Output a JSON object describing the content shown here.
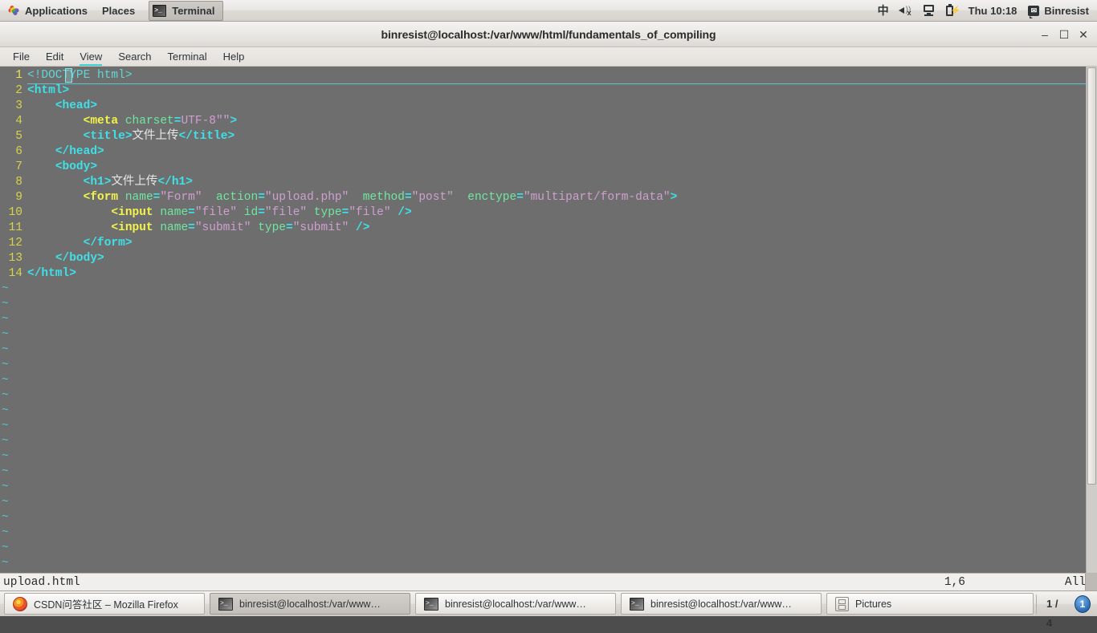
{
  "top_panel": {
    "applications_label": "Applications",
    "places_label": "Places",
    "window_task_label": "Terminal",
    "input_method": "中",
    "clock": "Thu 10:18",
    "user": "Binresist",
    "tray_icons": [
      "input-method-icon",
      "volume-muted-icon",
      "display-icon",
      "battery-icon",
      "messaging-icon"
    ]
  },
  "window": {
    "title": "binresist@localhost:/var/www/html/fundamentals_of_compiling",
    "minimize_glyph": "–",
    "maximize_glyph": "☐",
    "close_glyph": "✕",
    "menus": [
      {
        "label": "File",
        "active": false
      },
      {
        "label": "Edit",
        "active": false
      },
      {
        "label": "View",
        "active": true
      },
      {
        "label": "Search",
        "active": false
      },
      {
        "label": "Terminal",
        "active": false
      },
      {
        "label": "Help",
        "active": false
      }
    ]
  },
  "editor": {
    "lines": [
      {
        "num": "1",
        "cursor": true,
        "tokens": [
          {
            "t": "doctype",
            "v": "<!DOCTYPE html>"
          }
        ]
      },
      {
        "num": "2",
        "cursor": false,
        "tokens": [
          {
            "t": "tag",
            "v": "<html>"
          }
        ]
      },
      {
        "num": "3",
        "cursor": false,
        "tokens": [
          {
            "t": "txt",
            "v": "    "
          },
          {
            "t": "tag",
            "v": "<head>"
          }
        ]
      },
      {
        "num": "4",
        "cursor": false,
        "tokens": [
          {
            "t": "txt",
            "v": "        "
          },
          {
            "t": "tagb",
            "v": "<meta"
          },
          {
            "t": "txt",
            "v": " "
          },
          {
            "t": "attr",
            "v": "charset"
          },
          {
            "t": "eq",
            "v": "="
          },
          {
            "t": "str",
            "v": "UTF-8\"\""
          },
          {
            "t": "tag",
            "v": ">"
          }
        ]
      },
      {
        "num": "5",
        "cursor": false,
        "tokens": [
          {
            "t": "txt",
            "v": "        "
          },
          {
            "t": "tag",
            "v": "<title>"
          },
          {
            "t": "txt",
            "v": "文件上传"
          },
          {
            "t": "tag",
            "v": "</title>"
          }
        ]
      },
      {
        "num": "6",
        "cursor": false,
        "tokens": [
          {
            "t": "txt",
            "v": "    "
          },
          {
            "t": "tag",
            "v": "</head>"
          }
        ]
      },
      {
        "num": "7",
        "cursor": false,
        "tokens": [
          {
            "t": "txt",
            "v": "    "
          },
          {
            "t": "tag",
            "v": "<body>"
          }
        ]
      },
      {
        "num": "8",
        "cursor": false,
        "tokens": [
          {
            "t": "txt",
            "v": "        "
          },
          {
            "t": "tag",
            "v": "<h1>"
          },
          {
            "t": "txt",
            "v": "文件上传"
          },
          {
            "t": "tag",
            "v": "</h1>"
          }
        ]
      },
      {
        "num": "9",
        "cursor": false,
        "tokens": [
          {
            "t": "txt",
            "v": "        "
          },
          {
            "t": "tagb",
            "v": "<form"
          },
          {
            "t": "txt",
            "v": " "
          },
          {
            "t": "attr",
            "v": "name"
          },
          {
            "t": "eq",
            "v": "="
          },
          {
            "t": "str",
            "v": "\"Form\""
          },
          {
            "t": "txt",
            "v": "  "
          },
          {
            "t": "attr",
            "v": "action"
          },
          {
            "t": "eq",
            "v": "="
          },
          {
            "t": "str",
            "v": "\"upload.php\""
          },
          {
            "t": "txt",
            "v": "  "
          },
          {
            "t": "attr",
            "v": "method"
          },
          {
            "t": "eq",
            "v": "="
          },
          {
            "t": "str",
            "v": "\"post\""
          },
          {
            "t": "txt",
            "v": "  "
          },
          {
            "t": "attr",
            "v": "enctype"
          },
          {
            "t": "eq",
            "v": "="
          },
          {
            "t": "str",
            "v": "\"multipart/form-data\""
          },
          {
            "t": "tag",
            "v": ">"
          }
        ]
      },
      {
        "num": "10",
        "cursor": false,
        "tokens": [
          {
            "t": "txt",
            "v": "            "
          },
          {
            "t": "tagb",
            "v": "<input"
          },
          {
            "t": "txt",
            "v": " "
          },
          {
            "t": "attr",
            "v": "name"
          },
          {
            "t": "eq",
            "v": "="
          },
          {
            "t": "str",
            "v": "\"file\""
          },
          {
            "t": "txt",
            "v": " "
          },
          {
            "t": "attr",
            "v": "id"
          },
          {
            "t": "eq",
            "v": "="
          },
          {
            "t": "str",
            "v": "\"file\""
          },
          {
            "t": "txt",
            "v": " "
          },
          {
            "t": "attr",
            "v": "type"
          },
          {
            "t": "eq",
            "v": "="
          },
          {
            "t": "str",
            "v": "\"file\""
          },
          {
            "t": "txt",
            "v": " "
          },
          {
            "t": "slash",
            "v": "/>"
          }
        ]
      },
      {
        "num": "11",
        "cursor": false,
        "tokens": [
          {
            "t": "txt",
            "v": "            "
          },
          {
            "t": "tagb",
            "v": "<input"
          },
          {
            "t": "txt",
            "v": " "
          },
          {
            "t": "attr",
            "v": "name"
          },
          {
            "t": "eq",
            "v": "="
          },
          {
            "t": "str",
            "v": "\"submit\""
          },
          {
            "t": "txt",
            "v": " "
          },
          {
            "t": "attr",
            "v": "type"
          },
          {
            "t": "eq",
            "v": "="
          },
          {
            "t": "str",
            "v": "\"submit\""
          },
          {
            "t": "txt",
            "v": " "
          },
          {
            "t": "slash",
            "v": "/>"
          }
        ]
      },
      {
        "num": "12",
        "cursor": false,
        "tokens": [
          {
            "t": "txt",
            "v": "        "
          },
          {
            "t": "tag",
            "v": "</form>"
          }
        ]
      },
      {
        "num": "13",
        "cursor": false,
        "tokens": [
          {
            "t": "txt",
            "v": "    "
          },
          {
            "t": "tag",
            "v": "</body>"
          }
        ]
      },
      {
        "num": "14",
        "cursor": false,
        "tokens": [
          {
            "t": "tag",
            "v": "</html>"
          }
        ]
      }
    ],
    "empty_marker": "~",
    "empty_line_count": 19
  },
  "status_bar": {
    "filename": "upload.html",
    "position": "1,6",
    "scroll": "All"
  },
  "taskbar": {
    "tasks": [
      {
        "label": "CSDN问答社区 – Mozilla Firefox",
        "icon": "firefox-icon",
        "active": false,
        "size": "task-ff"
      },
      {
        "label": "binresist@localhost:/var/www…",
        "icon": "terminal-icon",
        "active": true,
        "size": "task-t"
      },
      {
        "label": "binresist@localhost:/var/www…",
        "icon": "terminal-icon",
        "active": false,
        "size": "task-t"
      },
      {
        "label": "binresist@localhost:/var/www…",
        "icon": "terminal-icon",
        "active": false,
        "size": "task-t"
      },
      {
        "label": "Pictures",
        "icon": "files-icon",
        "active": false,
        "size": "task-p"
      }
    ],
    "workspace": "1 / 4",
    "notification_count": "1"
  },
  "colors": {
    "terminal_bg": "#6e6e6e",
    "tag": "#3fe0e8",
    "tag_bold": "#f3f34b",
    "attr": "#6ee8a0",
    "string": "#d09fd0",
    "linenum": "#d7d34a",
    "accent": "#3fd3d6"
  }
}
